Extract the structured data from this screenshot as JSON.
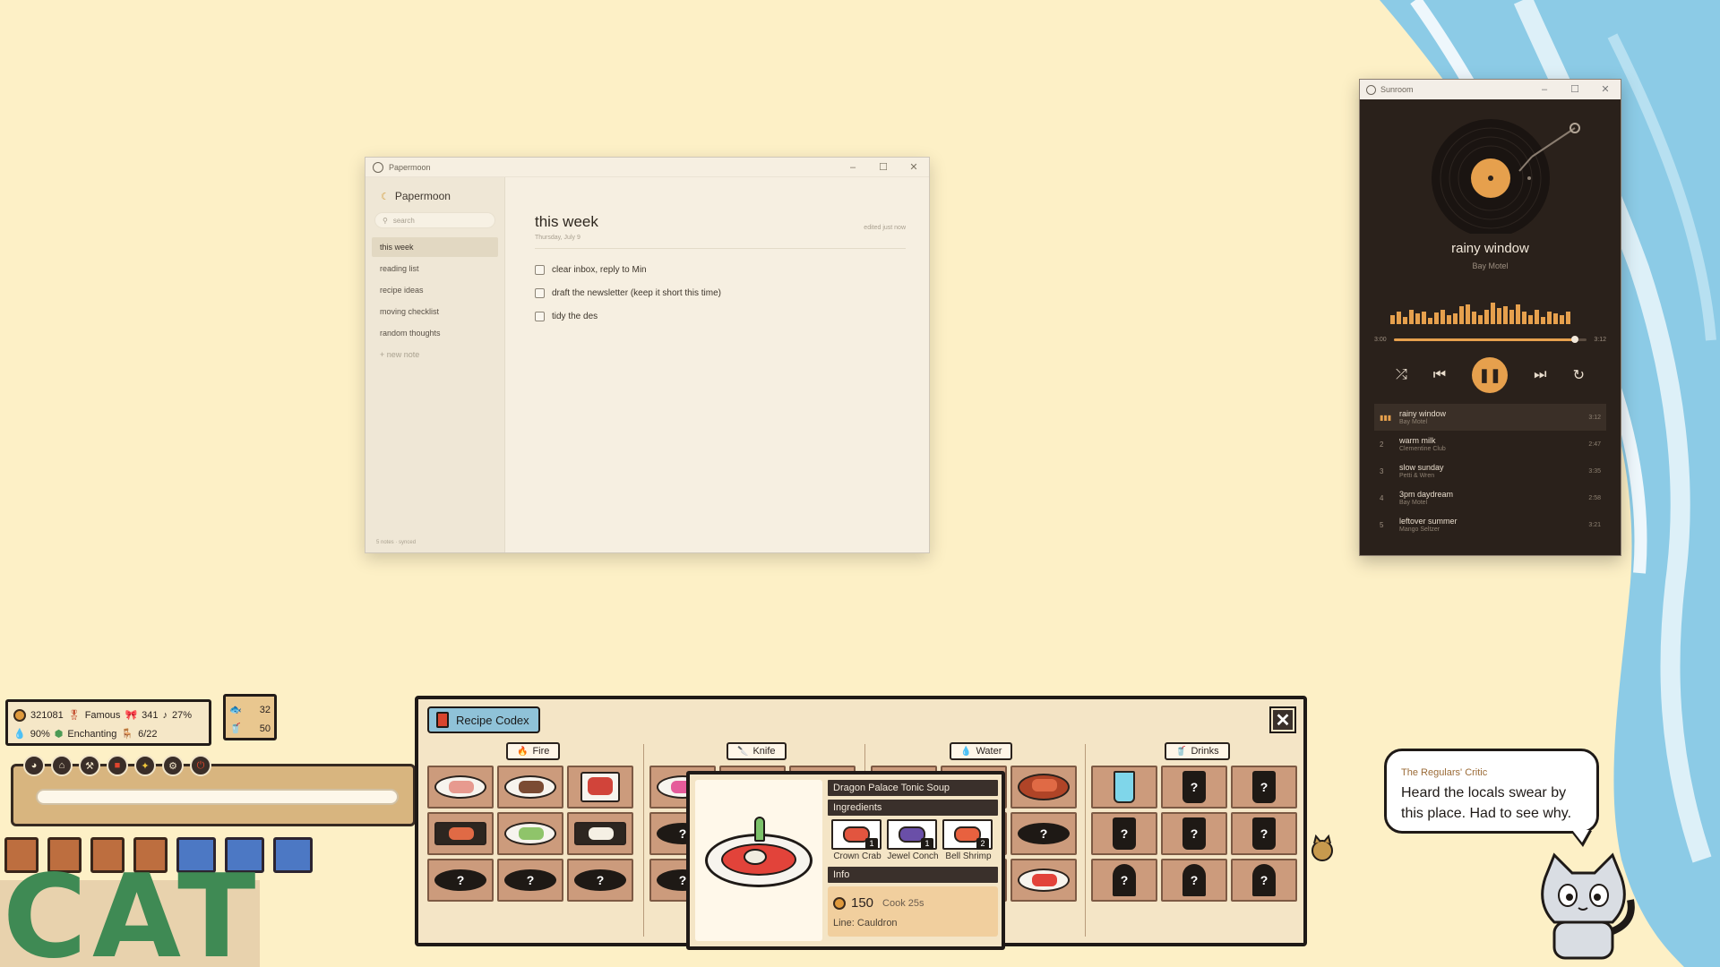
{
  "papermoon": {
    "window_title": "Papermoon",
    "app_name": "Papermoon",
    "search_placeholder": "search",
    "sidebar": [
      {
        "label": "this week",
        "active": true
      },
      {
        "label": "reading list"
      },
      {
        "label": "recipe ideas"
      },
      {
        "label": "moving checklist"
      },
      {
        "label": "random thoughts"
      }
    ],
    "new_note": "+ new note",
    "footer": "5 notes · synced",
    "note": {
      "title": "this week",
      "date": "Thursday, July 9",
      "edited": "edited just now",
      "todos": [
        "clear inbox, reply to Min",
        "draft the newsletter (keep it short this time)",
        "tidy the des"
      ]
    }
  },
  "sunroom": {
    "window_title": "Sunroom",
    "now_playing": {
      "title": "rainy window",
      "artist": "Bay Motel"
    },
    "elapsed": "3:00",
    "total": "3:12",
    "progress": 0.94,
    "visualizer": [
      10,
      14,
      8,
      16,
      12,
      14,
      7,
      13,
      16,
      10,
      12,
      20,
      22,
      14,
      10,
      16,
      24,
      18,
      20,
      16,
      22,
      14,
      10,
      16,
      8,
      14,
      12,
      10,
      14
    ],
    "accent": "#e6a04d",
    "tracks": [
      {
        "num": "",
        "title": "rainy window",
        "artist": "Bay Motel",
        "duration": "3:12"
      },
      {
        "num": "2",
        "title": "warm milk",
        "artist": "Clementine Club",
        "duration": "2:47"
      },
      {
        "num": "3",
        "title": "slow sunday",
        "artist": "Petti & Wren",
        "duration": "3:35"
      },
      {
        "num": "4",
        "title": "3pm daydream",
        "artist": "Bay Motel",
        "duration": "2:58"
      },
      {
        "num": "5",
        "title": "leftover summer",
        "artist": "Mango Seltzer",
        "duration": "3:21"
      }
    ]
  },
  "hud": {
    "coins": "321081",
    "fame": "Famous",
    "bows": "341",
    "music_pct": "27%",
    "water_pct": "90%",
    "mood": "Enchanting",
    "seats": "6/22",
    "fish": "32",
    "drinks": "50",
    "banner": "CAT"
  },
  "codex": {
    "tab_label": "Recipe Codex",
    "categories": [
      {
        "label": "Fire",
        "icon": "flame-icon",
        "glyph": "🔥"
      },
      {
        "label": "Knife",
        "icon": "knife-icon",
        "glyph": "🔪"
      },
      {
        "label": "Water",
        "icon": "water-icon",
        "glyph": "💧"
      },
      {
        "label": "Drinks",
        "icon": "cup-icon",
        "glyph": "🥤"
      }
    ],
    "unknown_mark": "?",
    "detail": {
      "name": "Dragon Palace Tonic Soup",
      "ingredients_label": "Ingredients",
      "ingredients": [
        {
          "name": "Crown Crab",
          "qty": "1",
          "color": "#e2553f"
        },
        {
          "name": "Jewel Conch",
          "qty": "1",
          "color": "#6a4fa8"
        },
        {
          "name": "Bell Shrimp",
          "qty": "2",
          "color": "#e8613f"
        }
      ],
      "info_label": "Info",
      "price": "150",
      "cook": "Cook 25s",
      "line": "Line: Cauldron"
    }
  },
  "critic": {
    "name": "The Regulars' Critic",
    "message": "Heard the locals swear by this place. Had to see why."
  }
}
